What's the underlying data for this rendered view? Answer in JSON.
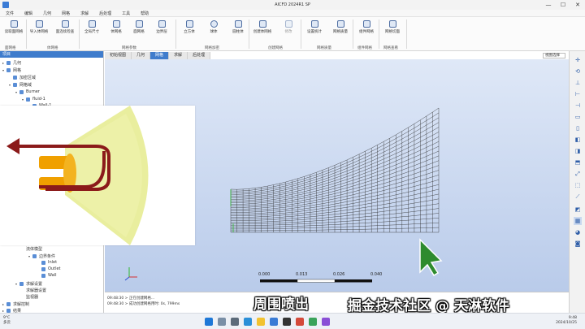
{
  "window": {
    "title": "AICFD 2024R1 SP",
    "controls": [
      "—",
      "☐",
      "✕"
    ]
  },
  "menu": [
    "文件",
    "编辑",
    "几何",
    "网格",
    "求解",
    "后处理",
    "工具",
    "帮助"
  ],
  "ribbon": {
    "buttons": [
      "读取面网格",
      "导入体网格",
      "面连续检查",
      "全局尺寸",
      "体网格",
      "面网格",
      "边界层",
      "立方体",
      "球体",
      "圆柱体",
      "创建体网格",
      "修改",
      "设置统计",
      "网格质量",
      "组件网格",
      "网格切面"
    ],
    "groups": [
      "面网格",
      "体网格",
      "网格参数",
      "网格加密",
      "创建网格",
      "网格质量",
      "组件网格",
      "网格查看"
    ]
  },
  "tree": {
    "header": "项目",
    "nodes": [
      "几何",
      "网格",
      "加密区域",
      "网格域",
      "Burner",
      "fluid-1",
      "Wall-1",
      "...",
      "流体模型",
      "边界条件",
      "Inlet",
      "Outlet",
      "Wall",
      "求解设置",
      "求解器设置",
      "监视器",
      "求解控制",
      "结果"
    ]
  },
  "view": {
    "tabs": [
      "初始视图",
      "几何",
      "网格",
      "求解",
      "后处理"
    ],
    "view_select": "视图选择",
    "scale_labels": [
      "0.000",
      "0.013",
      "0.026",
      "0.040"
    ]
  },
  "messages": [
    "09:48:30 > 正在创建网格...",
    "09:48:30 > 成功创建网格用时: 0s, 799ms"
  ],
  "taskbar": {
    "weather_temp": "9°C",
    "weather_desc": "多云",
    "time": "9:48",
    "date": "2024/10/25"
  },
  "caption": "周围喷出",
  "watermark": "掘金技术社区 @ 天淋软件",
  "colors": {
    "accent": "#3f7ccc",
    "flame": "#e8ee9a",
    "arrow": "#8b1a1a",
    "nozzle": "#f0a000",
    "cursor": "#2e8b2e"
  }
}
